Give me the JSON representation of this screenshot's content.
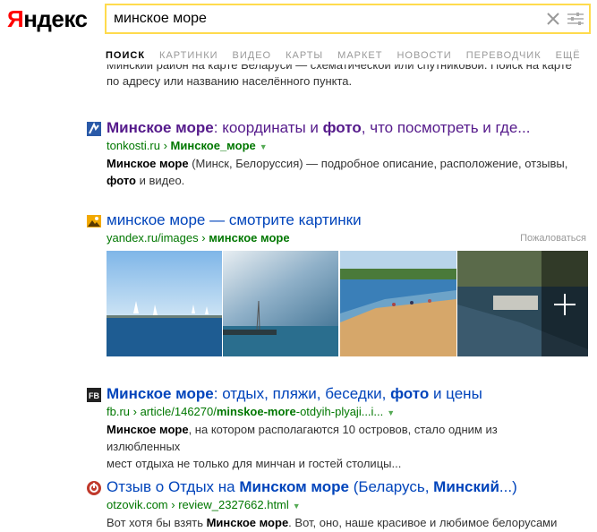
{
  "logo": {
    "first": "Я",
    "rest": "ндекс"
  },
  "search": {
    "value": "минское море",
    "clear_icon": "close-icon",
    "filters_icon": "sliders-icon"
  },
  "nav": [
    "ПОИСК",
    "КАРТИНКИ",
    "ВИДЕО",
    "КАРТЫ",
    "МАРКЕТ",
    "НОВОСТИ",
    "ПЕРЕВОДЧИК",
    "ЕЩЁ"
  ],
  "clipped_snippet": {
    "line1": "Минский район на карте Беларуси — схематической или спутниковой. Поиск на карте",
    "line2": "по адресу или названию населённого пункта."
  },
  "results": [
    {
      "title_bold1": "Минское море",
      "title_mid": ": координаты и ",
      "title_bold2": "фото",
      "title_rest": ", что посмотреть и где...",
      "url_host": "tonkosti.ru",
      "url_sep": " › ",
      "url_path": "Минское_море",
      "url_arrow": "▼",
      "snip_bold1": "Минское море",
      "snip_rest1": " (Минск, Белоруссия) — подробное описание, расположение, отзывы,",
      "snip_bold2": "фото",
      "snip_rest2": " и видео."
    },
    {
      "title": "минское море — смотрите картинки",
      "url_host": "yandex.ru/images",
      "url_sep": " › ",
      "url_path": "минское море",
      "complain": "Пожаловаться"
    },
    {
      "title_bold1": "Минское море",
      "title_mid": ": отдых, пляжи, беседки, ",
      "title_bold2": "фото",
      "title_rest": " и цены",
      "url_host": "fb.ru",
      "url_sep": " › ",
      "url_mid": "article/146270/",
      "url_path": "minskoe-more",
      "url_rest": "-otdyih-plyaji...i...",
      "url_arrow": "▼",
      "snip_bold1": "Минское море",
      "snip_rest1": ", на котором располагаются 10 островов, стало одним из излюбленных",
      "snip_line2": "мест отдыха не только для минчан и гостей столицы..."
    },
    {
      "title_pre": "Отзыв о Отдых на ",
      "title_bold1": "Минском море",
      "title_mid": " (Беларусь, ",
      "title_bold2": "Минский",
      "title_rest": "...)",
      "url_host": "otzovik.com",
      "url_sep": " › ",
      "url_path": "review_2327662.html",
      "url_arrow": "▼",
      "snip_pre": "Вот хотя бы взять ",
      "snip_bold1": "Минское море",
      "snip_rest1": ". Вот, оно, наше красивое и любимое белорусами"
    }
  ]
}
